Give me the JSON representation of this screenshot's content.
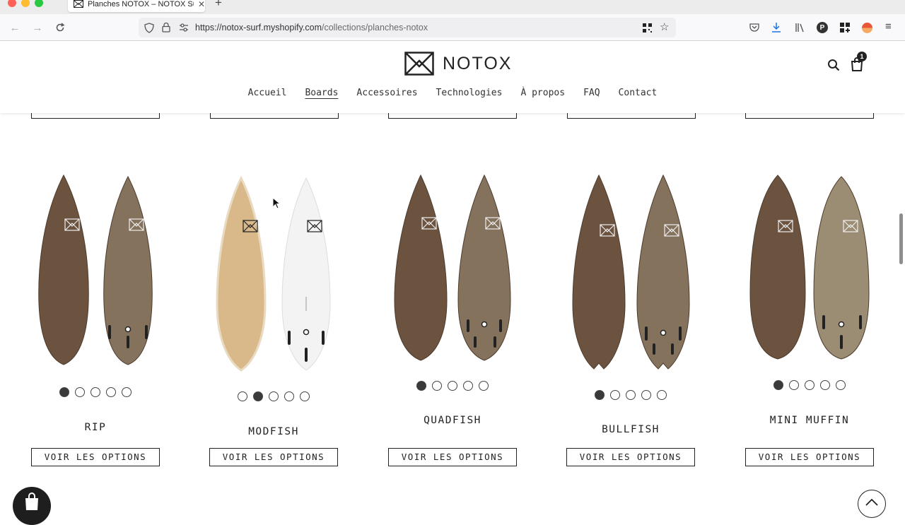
{
  "browser": {
    "tab_title": "Planches NOTOX – NOTOX Surf",
    "url_host": "https://notox-surf.myshopify.com",
    "url_path": "/collections/planches-notox"
  },
  "site": {
    "brand": "NOTOX",
    "cart_count": "1",
    "menu": [
      {
        "label": "Accueil",
        "active": false
      },
      {
        "label": "Boards",
        "active": true
      },
      {
        "label": "Accessoires",
        "active": false
      },
      {
        "label": "Technologies",
        "active": false
      },
      {
        "label": "À propos",
        "active": false
      },
      {
        "label": "FAQ",
        "active": false
      },
      {
        "label": "Contact",
        "active": false
      }
    ]
  },
  "grid": {
    "button_label": "VOIR LES OPTIONS",
    "products": [
      {
        "name": "RIP",
        "selected_variant": 1,
        "variants": 5,
        "deck_color": "#6b5340",
        "bottom_color": "#85725d"
      },
      {
        "name": "MODFISH",
        "selected_variant": 2,
        "variants": 5,
        "deck_color": "#d9b98a",
        "bottom_color": "#f3f3f3"
      },
      {
        "name": "QUADFISH",
        "selected_variant": 1,
        "variants": 5,
        "deck_color": "#6b5340",
        "bottom_color": "#85725d"
      },
      {
        "name": "BULLFISH",
        "selected_variant": 1,
        "variants": 5,
        "deck_color": "#6b5340",
        "bottom_color": "#85725d"
      },
      {
        "name": "MINI MUFFIN",
        "selected_variant": 1,
        "variants": 5,
        "deck_color": "#6b5340",
        "bottom_color": "#9b8c74"
      }
    ]
  }
}
